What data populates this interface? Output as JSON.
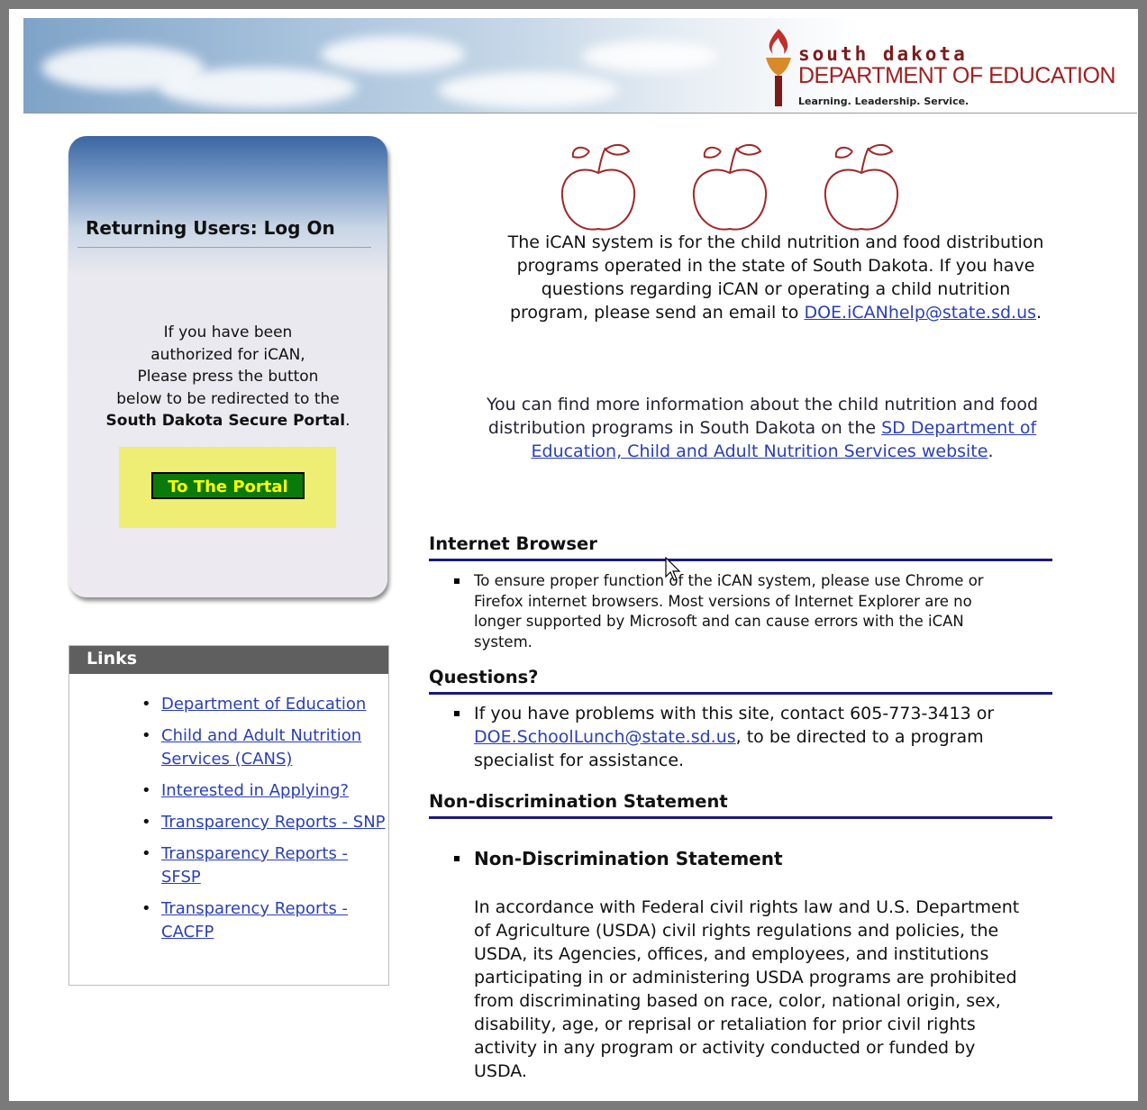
{
  "header": {
    "logo_line1": "south dakota",
    "logo_line2": "DEPARTMENT OF EDUCATION",
    "logo_tagline": "Learning. Leadership. Service."
  },
  "login": {
    "title": "Returning Users: Log On",
    "line1": "If you have been",
    "line2": "authorized for iCAN,",
    "line3": "Please press the button",
    "line4": "below to be redirected to the",
    "line5": "South Dakota Secure Portal",
    "line5_end": ".",
    "button_label": "To The Portal"
  },
  "links": {
    "heading": "Links",
    "items": [
      {
        "label": "Department of Education"
      },
      {
        "label": "Child and Adult Nutrition Services (CANS)"
      },
      {
        "label": "Interested in Applying?"
      },
      {
        "label": "Transparency Reports - SNP"
      },
      {
        "label": "Transparency Reports - SFSP"
      },
      {
        "label": "Transparency Reports - CACFP"
      }
    ]
  },
  "intro": {
    "text": "The iCAN system is for the child nutrition and food distribution programs operated in the state of South Dakota. If you have questions regarding iCAN or operating a child nutrition program, please send an email to ",
    "email": "DOE.iCANhelp@state.sd.us",
    "end": "."
  },
  "more_info": {
    "text": "You can find more information about the child nutrition and food distribution programs in South Dakota on the ",
    "link": "SD Department of Education, Child and Adult Nutrition Services website",
    "end": "."
  },
  "sections": {
    "browser": {
      "heading": "Internet Browser",
      "text": "To ensure proper function of the iCAN system, please use Chrome or Firefox internet browsers. Most versions of Internet Explorer are no longer supported by Microsoft and can cause errors with the iCAN system."
    },
    "questions": {
      "heading": "Questions?",
      "text_a": "If you have problems with this site, contact 605-773-3413 or ",
      "email": "DOE.SchoolLunch@state.sd.us",
      "text_b": ", to be directed to a program specialist for assistance."
    },
    "nondiscrimination": {
      "heading": "Non-discrimination Statement",
      "item_title": "Non-Discrimination Statement",
      "body": "In accordance with Federal civil rights law and U.S. Department of Agriculture (USDA) civil rights regulations and policies, the USDA, its Agencies, offices, and employees, and institutions participating in or administering USDA programs are prohibited from discriminating based on race, color, national origin, sex, disability, age, or reprisal or retaliation for prior civil rights activity in any program or activity conducted or funded by USDA."
    }
  },
  "colors": {
    "link": "#2a3fb4",
    "heading_rule": "#1a1a7a",
    "portal_button_bg": "#0a7a0a",
    "portal_button_text": "#ffff00",
    "portal_wrap_bg": "#eeed74",
    "links_header_bg": "#5f5f5f",
    "apple_stroke": "#a02828"
  },
  "icons": [
    "torch-logo-icon",
    "apple-icon",
    "mouse-cursor-icon"
  ]
}
